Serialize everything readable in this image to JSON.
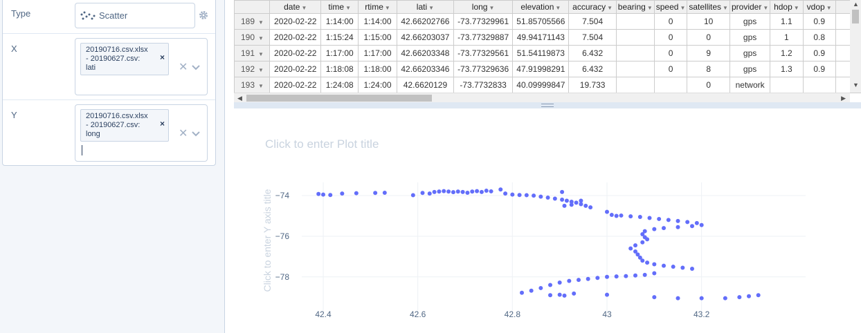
{
  "sidebar": {
    "type": {
      "label": "Type",
      "value": "Scatter"
    },
    "x": {
      "label": "X",
      "chip_lines": [
        "20190716.csv.xlsx",
        "- 20190627.csv:",
        "lati"
      ]
    },
    "y": {
      "label": "Y",
      "chip_lines": [
        "20190716.csv.xlsx",
        "- 20190627.csv:",
        "long"
      ]
    }
  },
  "grid": {
    "columns": [
      "",
      "date",
      "time",
      "rtime",
      "lati",
      "long",
      "elevation",
      "accuracy",
      "bearing",
      "speed",
      "satellites",
      "provider",
      "hdop",
      "vdop"
    ],
    "rows": [
      [
        "189",
        "2020-02-22",
        "1:14:00",
        "1:14:00",
        "42.66202766",
        "-73.77329961",
        "51.85705566",
        "7.504",
        "",
        "0",
        "10",
        "gps",
        "1.1",
        "0.9"
      ],
      [
        "190",
        "2020-02-22",
        "1:15:24",
        "1:15:00",
        "42.66203037",
        "-73.77329887",
        "49.94171143",
        "7.504",
        "",
        "0",
        "0",
        "gps",
        "1",
        "0.8"
      ],
      [
        "191",
        "2020-02-22",
        "1:17:00",
        "1:17:00",
        "42.66203348",
        "-73.77329561",
        "51.54119873",
        "6.432",
        "",
        "0",
        "9",
        "gps",
        "1.2",
        "0.9"
      ],
      [
        "192",
        "2020-02-22",
        "1:18:08",
        "1:18:00",
        "42.66203346",
        "-73.77329636",
        "47.91998291",
        "6.432",
        "",
        "0",
        "8",
        "gps",
        "1.3",
        "0.9"
      ],
      [
        "193",
        "2020-02-22",
        "1:24:08",
        "1:24:00",
        "42.6620129",
        "-73.7732833",
        "40.09999847",
        "19.733",
        "",
        "",
        "0",
        "network",
        "",
        ""
      ]
    ]
  },
  "plot": {
    "title_placeholder": "Click to enter Plot title",
    "ytitle_placeholder": "Click to enter Y axis title"
  },
  "chart_data": {
    "type": "scatter",
    "title": "",
    "xlabel": "",
    "ylabel": "",
    "xlim": [
      42.34,
      43.42
    ],
    "ylim": [
      -79.3,
      -73.35
    ],
    "x_ticks": [
      42.4,
      42.6,
      42.8,
      43,
      43.2
    ],
    "y_ticks": [
      -74,
      -76,
      -78
    ],
    "marker_color": "#636efa",
    "points": [
      [
        42.39,
        -73.92
      ],
      [
        42.4,
        -73.95
      ],
      [
        42.415,
        -73.97
      ],
      [
        42.44,
        -73.9
      ],
      [
        42.47,
        -73.88
      ],
      [
        42.51,
        -73.87
      ],
      [
        42.53,
        -73.86
      ],
      [
        42.59,
        -73.98
      ],
      [
        42.61,
        -73.87
      ],
      [
        42.625,
        -73.9
      ],
      [
        42.635,
        -73.82
      ],
      [
        42.645,
        -73.8
      ],
      [
        42.655,
        -73.78
      ],
      [
        42.665,
        -73.8
      ],
      [
        42.675,
        -73.83
      ],
      [
        42.685,
        -73.8
      ],
      [
        42.695,
        -73.82
      ],
      [
        42.705,
        -73.86
      ],
      [
        42.715,
        -73.8
      ],
      [
        42.725,
        -73.78
      ],
      [
        42.735,
        -73.82
      ],
      [
        42.745,
        -73.76
      ],
      [
        42.755,
        -73.79
      ],
      [
        42.775,
        -73.7
      ],
      [
        42.785,
        -73.9
      ],
      [
        42.8,
        -73.95
      ],
      [
        42.815,
        -73.97
      ],
      [
        42.83,
        -73.98
      ],
      [
        42.845,
        -74.0
      ],
      [
        42.86,
        -74.05
      ],
      [
        42.875,
        -74.1
      ],
      [
        42.89,
        -74.15
      ],
      [
        42.905,
        -74.2
      ],
      [
        42.915,
        -74.25
      ],
      [
        42.925,
        -74.3
      ],
      [
        42.935,
        -74.35
      ],
      [
        42.945,
        -74.42
      ],
      [
        42.955,
        -74.5
      ],
      [
        42.965,
        -74.58
      ],
      [
        42.945,
        -74.25
      ],
      [
        42.925,
        -74.45
      ],
      [
        42.91,
        -74.5
      ],
      [
        42.905,
        -73.82
      ],
      [
        43.0,
        -74.8
      ],
      [
        43.01,
        -74.95
      ],
      [
        43.02,
        -75.0
      ],
      [
        43.03,
        -74.98
      ],
      [
        43.05,
        -75.02
      ],
      [
        43.07,
        -75.05
      ],
      [
        43.09,
        -75.1
      ],
      [
        43.11,
        -75.15
      ],
      [
        43.13,
        -75.2
      ],
      [
        43.15,
        -75.25
      ],
      [
        43.17,
        -75.3
      ],
      [
        43.19,
        -75.35
      ],
      [
        43.2,
        -75.45
      ],
      [
        43.18,
        -75.5
      ],
      [
        43.15,
        -75.55
      ],
      [
        43.12,
        -75.6
      ],
      [
        43.1,
        -75.65
      ],
      [
        43.08,
        -75.75
      ],
      [
        43.075,
        -75.9
      ],
      [
        43.08,
        -76.05
      ],
      [
        43.085,
        -76.15
      ],
      [
        43.075,
        -76.3
      ],
      [
        43.06,
        -76.45
      ],
      [
        43.05,
        -76.6
      ],
      [
        43.06,
        -76.75
      ],
      [
        43.065,
        -76.9
      ],
      [
        43.07,
        -77.05
      ],
      [
        43.075,
        -77.2
      ],
      [
        43.085,
        -77.3
      ],
      [
        43.1,
        -77.38
      ],
      [
        43.12,
        -77.45
      ],
      [
        43.14,
        -77.5
      ],
      [
        43.16,
        -77.55
      ],
      [
        43.18,
        -77.6
      ],
      [
        43.1,
        -77.82
      ],
      [
        43.08,
        -77.9
      ],
      [
        43.06,
        -77.93
      ],
      [
        43.04,
        -77.96
      ],
      [
        43.02,
        -77.98
      ],
      [
        43.0,
        -78.0
      ],
      [
        42.98,
        -78.05
      ],
      [
        42.96,
        -78.1
      ],
      [
        42.94,
        -78.15
      ],
      [
        42.92,
        -78.2
      ],
      [
        42.9,
        -78.28
      ],
      [
        42.88,
        -78.4
      ],
      [
        42.86,
        -78.55
      ],
      [
        42.84,
        -78.68
      ],
      [
        42.82,
        -78.78
      ],
      [
        42.9,
        -78.88
      ],
      [
        42.88,
        -78.9
      ],
      [
        42.91,
        -78.92
      ],
      [
        42.93,
        -78.82
      ],
      [
        43.0,
        -78.88
      ],
      [
        43.1,
        -79.0
      ],
      [
        43.15,
        -79.05
      ],
      [
        43.2,
        -79.05
      ],
      [
        43.25,
        -79.05
      ],
      [
        43.28,
        -79.0
      ],
      [
        43.3,
        -78.95
      ],
      [
        43.32,
        -78.9
      ]
    ]
  }
}
